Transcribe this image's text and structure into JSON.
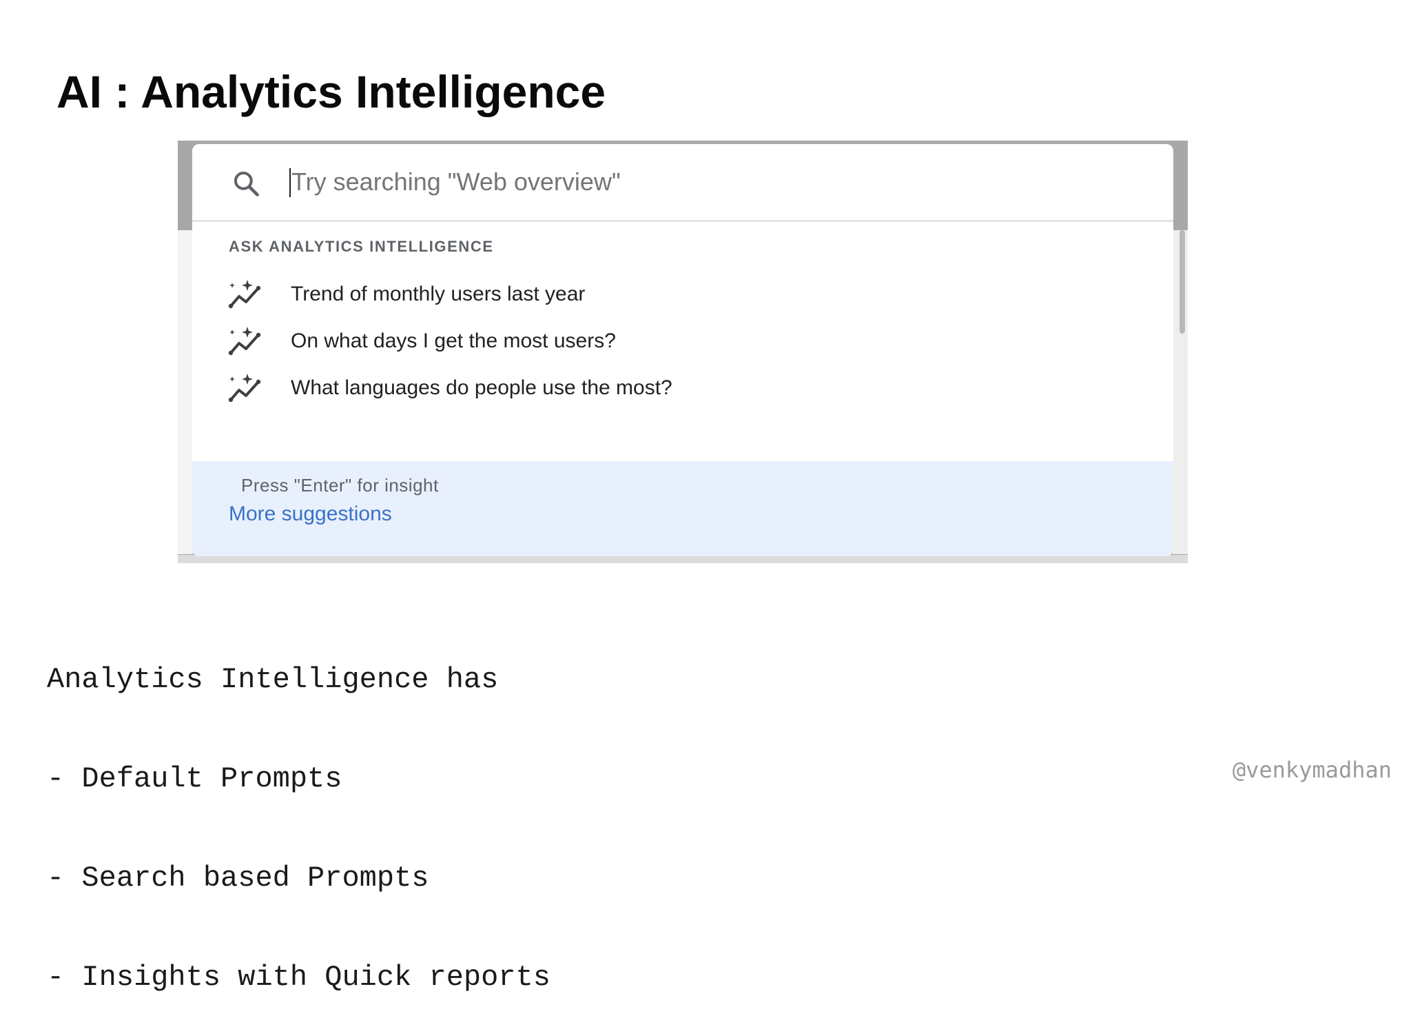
{
  "slide": {
    "title": "AI : Analytics Intelligence"
  },
  "popup": {
    "search": {
      "icon": "search-icon",
      "placeholder": "Try searching \"Web overview\"",
      "value": ""
    },
    "section_header": "ASK ANALYTICS INTELLIGENCE",
    "suggestions": [
      {
        "icon": "insights-sparkle-icon",
        "label": "Trend of monthly users last year"
      },
      {
        "icon": "insights-sparkle-icon",
        "label": "On what days I get the most users?"
      },
      {
        "icon": "insights-sparkle-icon",
        "label": "What languages do people use the most?"
      }
    ],
    "footer": {
      "hint": "Press \"Enter\" for insight",
      "more_link": "More suggestions",
      "background_color": "#e8f0fd",
      "link_color": "#3a72c4"
    }
  },
  "notes": [
    "Analytics Intelligence has",
    "- Default Prompts",
    "- Search based Prompts",
    "- Insights with Quick reports"
  ],
  "credit": "@venkymadhan"
}
